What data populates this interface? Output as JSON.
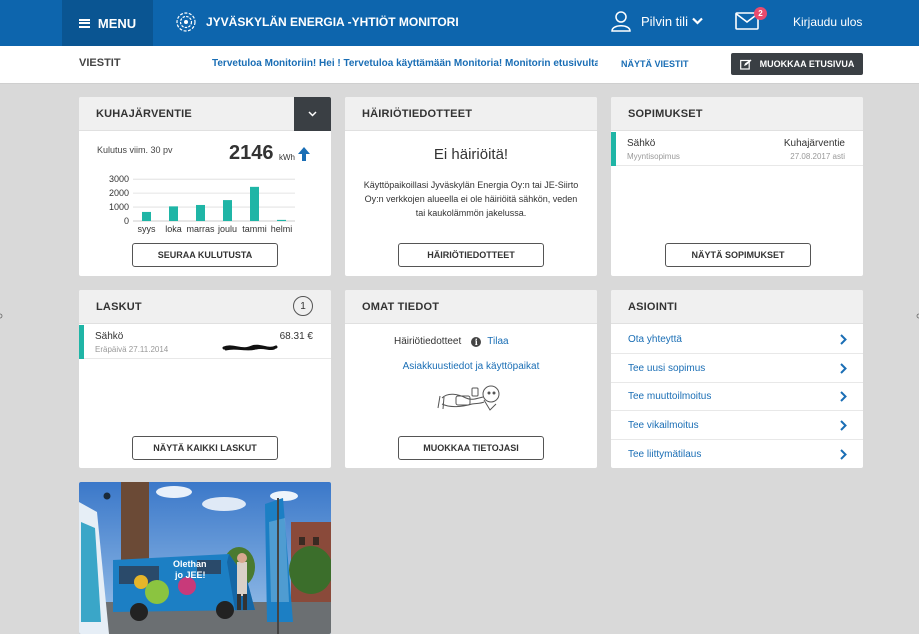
{
  "header": {
    "menu_label": "MENU",
    "brand_title": "JYVÄSKYLÄN ENERGIA -YHTIÖT MONITORI",
    "account_label": "Pilvin tili",
    "mail_badge": "2",
    "logout_label": "Kirjaudu ulos"
  },
  "messages": {
    "title": "VIESTIT",
    "text": "Tervetuloa Monitoriin! Hei ! Tervetuloa käyttämään Monitoria! Monitorin etusivulta nä...",
    "show_link": "NÄYTÄ VIESTIT",
    "edit_button": "MUOKKAA ETUSIVUA"
  },
  "consumption_card": {
    "title": "KUHAJÄRVENTIE",
    "label": "Kulutus viim. 30 pv",
    "value": "2146",
    "unit": "kWh",
    "button": "SEURAA KULUTUSTA",
    "chart_data": {
      "type": "bar",
      "categories": [
        "syys",
        "loka",
        "marras",
        "joulu",
        "tammi",
        "helmi"
      ],
      "values": [
        650,
        1050,
        1150,
        1500,
        2450,
        80
      ],
      "yticks": [
        0,
        1000,
        2000,
        3000
      ],
      "ylim": [
        0,
        3300
      ],
      "color": "#1fb5a6",
      "grid": true
    }
  },
  "outage_card": {
    "title": "HÄIRIÖTIEDOTTEET",
    "headline": "Ei häiriöitä!",
    "text": "Käyttöpaikoillasi Jyväskylän Energia Oy:n tai JE-Siirto Oy:n verkkojen alueella ei ole häiriöitä sähkön, veden tai kaukolämmön jakelussa.",
    "button": "HÄIRIÖTIEDOTTEET"
  },
  "contracts_card": {
    "title": "SOPIMUKSET",
    "item": {
      "name": "Sähkö",
      "type": "Myyntisopimus",
      "place": "Kuhajärventie",
      "valid": "27.08.2017 asti"
    },
    "button": "NÄYTÄ SOPIMUKSET"
  },
  "invoices_card": {
    "title": "LASKUT",
    "count": "1",
    "item": {
      "name": "Sähkö",
      "due": "Eräpäivä 27.11.2014",
      "amount": "68.31 €"
    },
    "button": "NÄYTÄ KAIKKI LASKUT"
  },
  "own_info_card": {
    "title": "OMAT TIEDOT",
    "outage_label": "Häiriötiedotteet",
    "subscribe_link": "Tilaa",
    "customer_link": "Asiakkuustiedot ja käyttöpaikat",
    "button": "MUOKKAA TIETOJASI"
  },
  "service_card": {
    "title": "ASIOINTI",
    "items": [
      "Ota yhteyttä",
      "Tee uusi sopimus",
      "Tee muuttoilmoitus",
      "Tee vikailmoitus",
      "Tee liittymätilaus"
    ]
  },
  "photo_card": {
    "flag_text_1": "Olethan",
    "flag_text_2": "jo JEE!"
  },
  "colors": {
    "header_blue": "#0d65ad",
    "accent_teal": "#1fb5a6",
    "link_blue": "#1a6eb5",
    "dark_button": "#3a3f44"
  }
}
